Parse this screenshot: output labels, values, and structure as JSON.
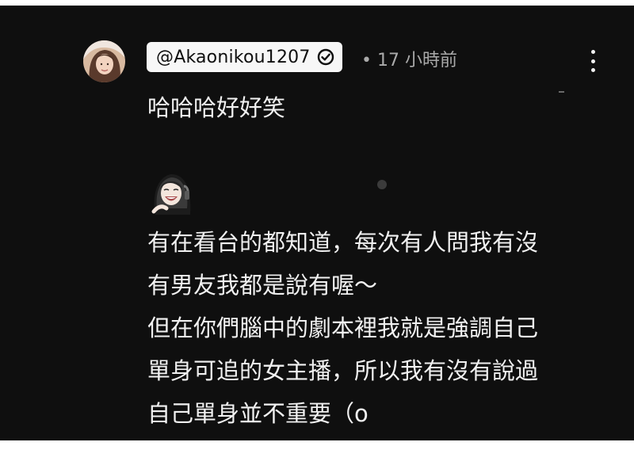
{
  "comment": {
    "author_handle": "@Akaonikou1207",
    "verified": true,
    "timestamp": "• 17 小時前",
    "text": "哈哈哈好好笑",
    "more_icon": "more-vert-icon",
    "avatar_icon": "user-avatar-photo"
  },
  "reply": {
    "sticker_icon": "laughing-girl-sticker",
    "lines": [
      "有在看台的都知道，每次有人問我有沒",
      "有男友我都是說有喔～",
      "但在你們腦中的劇本裡我就是強調自己",
      "單身可追的女主播，所以我有沒有說過",
      "自己單身並不重要（o"
    ]
  },
  "colors": {
    "background": "#0f0f0f",
    "text_primary": "#f1f1f1",
    "text_secondary": "#aaaaaa",
    "handle_chip": "#f7f7f7"
  }
}
